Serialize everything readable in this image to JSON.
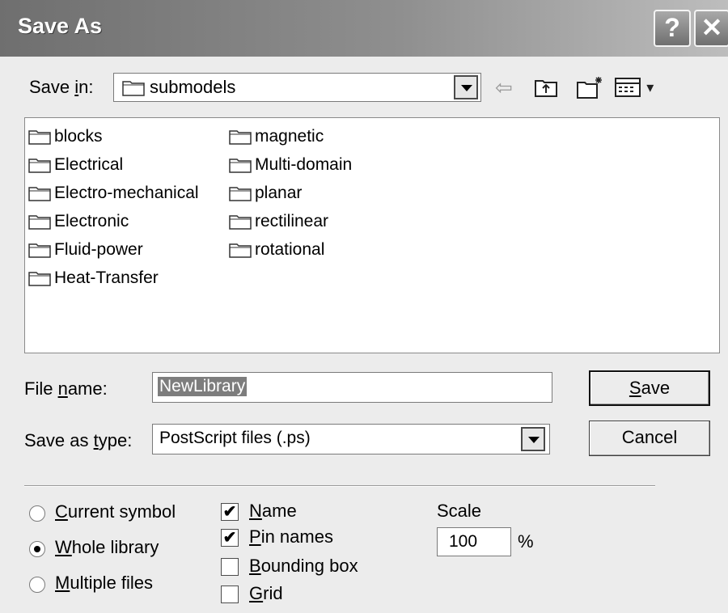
{
  "window": {
    "title": "Save As"
  },
  "titlebar": {
    "help_glyph": "?",
    "close_glyph": "✕"
  },
  "save_in": {
    "label_pre": "Save ",
    "label_accel": "i",
    "label_post": "n:",
    "value": "submodels",
    "icons": [
      "folder-icon",
      "back-arrow-icon",
      "up-folder-icon",
      "new-folder-icon",
      "view-menu-icon"
    ],
    "toolbar": {
      "back": "⇦",
      "views_caret": "▾"
    }
  },
  "folders": [
    "blocks",
    "Electrical",
    "Electro-mechanical",
    "Electronic",
    "Fluid-power",
    "Heat-Transfer",
    "magnetic",
    "Multi-domain",
    "planar",
    "rectilinear",
    "rotational"
  ],
  "file_name": {
    "label_pre": "File ",
    "label_accel": "n",
    "label_post": "ame:",
    "value": "NewLibrary"
  },
  "save_as_type": {
    "label_pre": "Save as ",
    "label_accel": "t",
    "label_post": "ype:",
    "value": "PostScript files (.ps)"
  },
  "buttons": {
    "save": {
      "accel": "S",
      "rest": "ave"
    },
    "cancel": "Cancel"
  },
  "scope": {
    "options": [
      {
        "accel": "C",
        "rest": "urrent symbol",
        "checked": false
      },
      {
        "accel": "W",
        "rest": "hole library",
        "checked": true
      },
      {
        "accel": "M",
        "rest": "ultiple files",
        "checked": false
      }
    ]
  },
  "include": {
    "check_glyph": "✔",
    "options": [
      {
        "accel": "N",
        "rest": "ame",
        "checked": true
      },
      {
        "accel": "P",
        "rest": "in names",
        "checked": true
      },
      {
        "accel": "B",
        "rest": "ounding box",
        "checked": false
      },
      {
        "accel": "G",
        "rest": "rid",
        "checked": false
      }
    ]
  },
  "scale": {
    "label": "Scale",
    "value": "100",
    "unit": "%"
  }
}
